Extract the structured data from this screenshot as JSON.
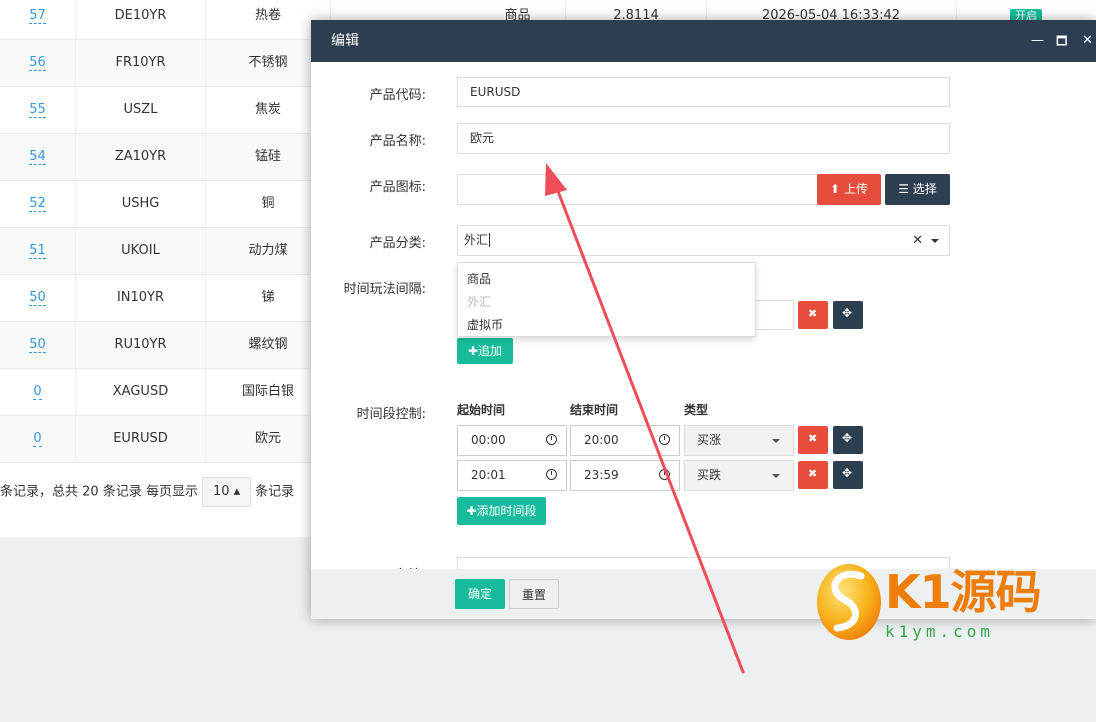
{
  "table": {
    "rows": [
      {
        "id": "57",
        "code": "DE10YR",
        "name": "热卷",
        "category": "商品",
        "price": "2.8114",
        "time": "2026-05-04 16:33:42",
        "status": "开启"
      },
      {
        "id": "56",
        "code": "FR10YR",
        "name": "不锈钢"
      },
      {
        "id": "55",
        "code": "USZL",
        "name": "焦炭"
      },
      {
        "id": "54",
        "code": "ZA10YR",
        "name": "锰硅"
      },
      {
        "id": "52",
        "code": "USHG",
        "name": "铜"
      },
      {
        "id": "51",
        "code": "UKOIL",
        "name": "动力煤"
      },
      {
        "id": "50",
        "code": "IN10YR",
        "name": "锑"
      },
      {
        "id": "50",
        "code": "RU10YR",
        "name": "螺纹钢"
      },
      {
        "id": "0",
        "code": "XAGUSD",
        "name": "国际白银"
      },
      {
        "id": "0",
        "code": "EURUSD",
        "name": "欧元"
      }
    ]
  },
  "pager": {
    "prefix": "条记录，总共 20 条记录 每页显示",
    "page_size": "10",
    "suffix": "条记录"
  },
  "modal": {
    "title": "编辑",
    "controls": {
      "minimize": "—",
      "maximize": "🗖",
      "close": "✕"
    },
    "labels": {
      "code": "产品代码:",
      "name": "产品名称:",
      "icon": "产品图标:",
      "category": "产品分类:",
      "interval": "时间玩法间隔:",
      "time_control": "时间段控制:",
      "remark": "备注:"
    },
    "values": {
      "code": "EURUSD",
      "name": "欧元",
      "icon": "",
      "category": "外汇"
    },
    "buttons": {
      "upload": "上传",
      "choose": "选择",
      "add": "追加",
      "add_period": "添加时间段",
      "ok": "确定",
      "reset": "重置"
    },
    "dropdown": {
      "options": [
        "商品",
        "外汇",
        "虚拟币"
      ]
    },
    "periods": {
      "headers": [
        "起始时间",
        "结束时间",
        "类型"
      ],
      "rows": [
        {
          "start": "00:00",
          "end": "20:00",
          "type": "买涨"
        },
        {
          "start": "20:01",
          "end": "23:59",
          "type": "买跌"
        }
      ]
    }
  },
  "watermark": {
    "brand": "K1源码",
    "url": "k1ym.com"
  },
  "colors": {
    "header": "#2c3e50",
    "danger": "#e74c3c",
    "success": "#18bc9c",
    "link": "#3498db",
    "arrow": "#ef4d5a"
  }
}
